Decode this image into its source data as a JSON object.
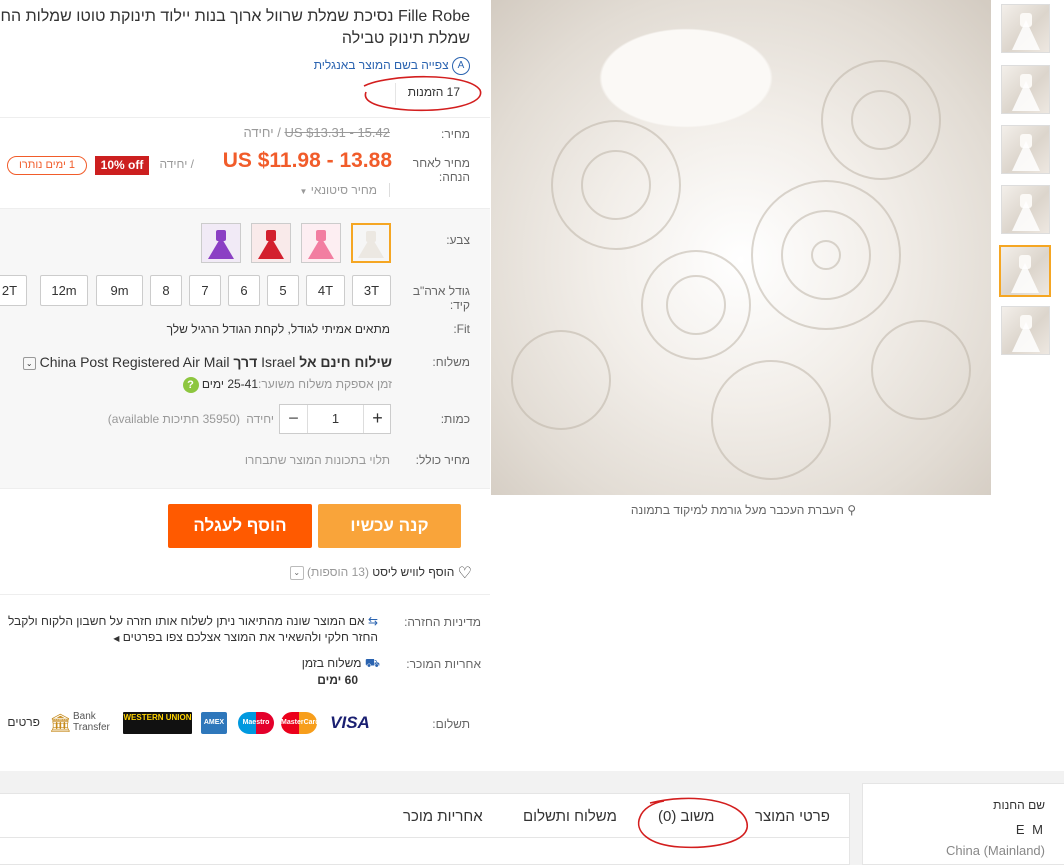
{
  "product": {
    "title_line1": "Fille Robe נסיכת שמלת שרוול ארוך בנות יילוד תינוקת טוטו שמלות החתונה",
    "title_line2": "שמלת תינוק טבילה",
    "translate_link": "צפייה בשם המוצר באנגלית",
    "orders": "17 הזמנות"
  },
  "price": {
    "label": "מחיר:",
    "original": "US $13.31 - 15.42",
    "original_unit": "/ יחידה",
    "discount_label": "מחיר לאחר הנחה:",
    "discount_price": "US $11.98 - 13.88",
    "discount_unit": "/ יחידה",
    "off_badge": "10% off",
    "days_left": "1 ימים נותרו",
    "wholesale": "מחיר סיטונאי"
  },
  "color": {
    "label": "צבע:",
    "options": [
      "white",
      "pink",
      "red",
      "purple"
    ]
  },
  "size": {
    "label": "גודל ארה\"ב קיד:",
    "options": [
      "3T",
      "4T",
      "5",
      "6",
      "7",
      "8",
      "9m",
      "12m",
      "2T"
    ]
  },
  "fit": {
    "label": "Fit:",
    "text": "מתאים אמיתי לגודל, לקחת הגודל הרגיל שלך"
  },
  "shipping": {
    "label": "משלוח:",
    "free_prefix": "שילוח חינם אל",
    "country": "Israel",
    "via": "דרך",
    "carrier": "China Post Registered Air Mail",
    "eta_label": "זמן אספקת משלוח משוער:",
    "eta_value": "25-41 ימים"
  },
  "quantity": {
    "label": "כמות:",
    "value": "1",
    "unit": "יחידה",
    "available": "(35950 חתיכות available)"
  },
  "total": {
    "label": "מחיר כולל:",
    "text": "תלוי בתכונות המוצר שתבחרו"
  },
  "buttons": {
    "buy_now": "קנה עכשיו",
    "add_to_cart": "הוסף לעגלה"
  },
  "wishlist": {
    "text": "הוסף לוויש ליסט",
    "count": "(13 הוספות)"
  },
  "returns": {
    "label": "מדיניות החזרה:",
    "line1": "אם המוצר שונה מהתיאור ניתן לשלוח אותו חזרה על חשבון הלקוח ולקבל",
    "line2_a": "החזר חלקי ולהשאיר את המוצר אצלכם",
    "line2_b": "צפו בפרטים"
  },
  "guarantee": {
    "label": "אחריות המוכר:",
    "line1": "משלוח בזמן",
    "line2": "60 ימים"
  },
  "payment": {
    "label": "תשלום:",
    "visa": "VISA",
    "mastercard": "MasterCard",
    "maestro": "Maestro",
    "amex": "AMEX",
    "western_union": "WESTERN UNION",
    "bank_transfer_1": "Bank",
    "bank_transfer_2": "Transfer",
    "details": "פרטים"
  },
  "image_hint": "העברת העכבר מעל גורמת למיקוד בתמונה",
  "tabs": {
    "details": "פרטי המוצר",
    "feedback": "משוב (0)",
    "shipping": "משלוח ותשלום",
    "guarantee": "אחריות מוכר"
  },
  "store": {
    "label": "שם החנות",
    "name": "E M",
    "location": "China (Mainland)"
  },
  "colors": {
    "accent_orange": "#f5a623",
    "buy_now": "#f9a43a",
    "add_to_cart": "#ff5a00",
    "price_red": "#f15c2a",
    "link_blue": "#2a63b0"
  }
}
